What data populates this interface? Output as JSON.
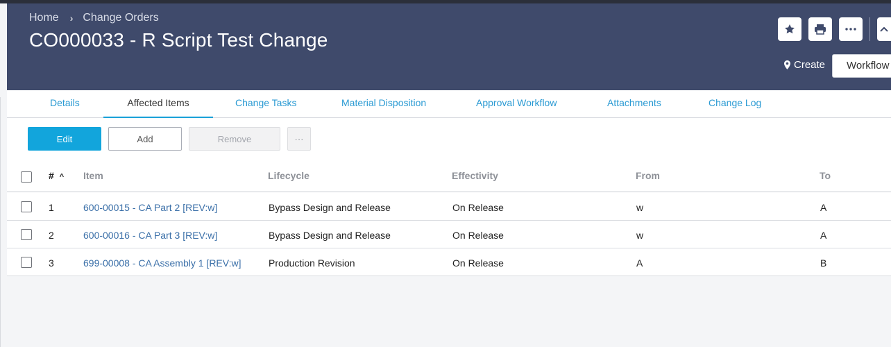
{
  "header": {
    "breadcrumb": {
      "home": "Home",
      "separator": "›",
      "current": "Change Orders"
    },
    "title": "CO000033 - R Script Test Change",
    "icons": [
      "star-icon",
      "print-icon",
      "more-icon",
      "collapse-icon",
      "map-pin-icon"
    ],
    "create_label": "Create",
    "workflow_label": "Workflow"
  },
  "tabs": [
    {
      "label": "Details",
      "active": false
    },
    {
      "label": "Affected Items",
      "active": true
    },
    {
      "label": "Change Tasks",
      "active": false
    },
    {
      "label": "Material Disposition",
      "active": false
    },
    {
      "label": "Approval Workflow",
      "active": false
    },
    {
      "label": "Attachments",
      "active": false
    },
    {
      "label": "Change Log",
      "active": false
    }
  ],
  "toolbar": {
    "edit_label": "Edit",
    "add_label": "Add",
    "remove_label": "Remove",
    "more_label": "···"
  },
  "table": {
    "columns": [
      "#",
      "Item",
      "Lifecycle",
      "Effectivity",
      "From",
      "To"
    ],
    "sort_indicator": "^",
    "rows": [
      {
        "num": "1",
        "item": "600-00015 - CA Part 2 [REV:w]",
        "lifecycle": "Bypass Design and Release",
        "effectivity": "On Release",
        "from": "w",
        "to": "A"
      },
      {
        "num": "2",
        "item": "600-00016 - CA Part 3 [REV:w]",
        "lifecycle": "Bypass Design and Release",
        "effectivity": "On Release",
        "from": "w",
        "to": "A"
      },
      {
        "num": "3",
        "item": "699-00008 - CA Assembly 1 [REV:w]",
        "lifecycle": "Production Revision",
        "effectivity": "On Release",
        "from": "A",
        "to": "B"
      }
    ]
  },
  "colors": {
    "header_bg": "#3f4a6b",
    "accent": "#12a5dc",
    "link": "#3a6fa8"
  }
}
